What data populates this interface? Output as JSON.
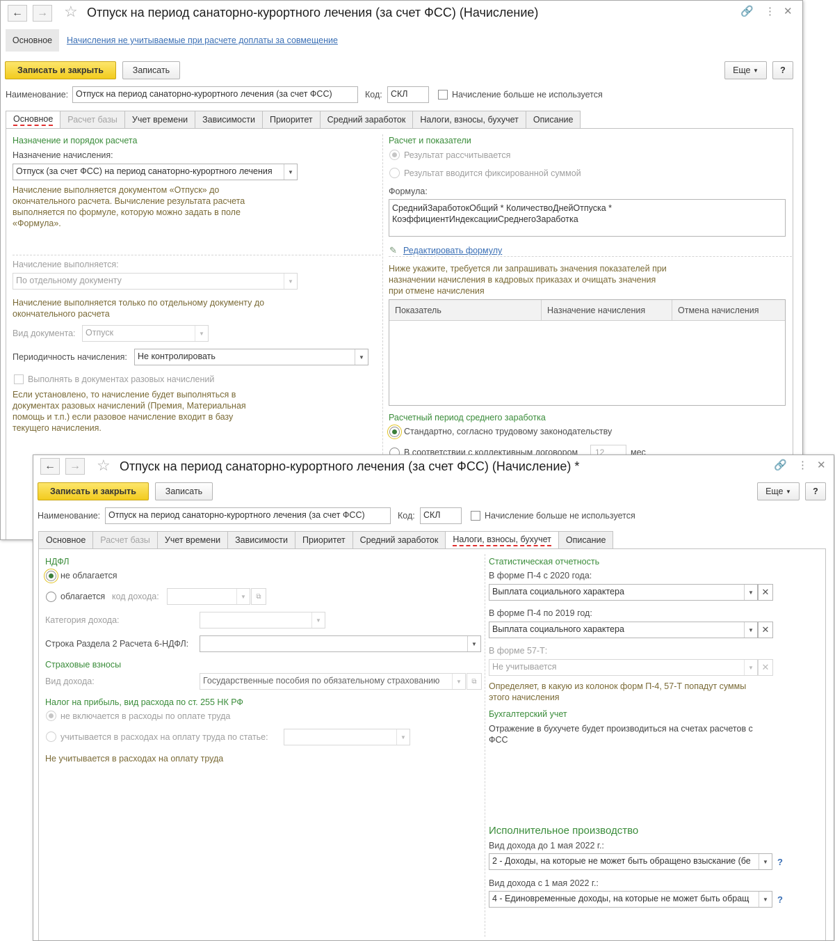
{
  "w1": {
    "title": "Отпуск на период санаторно-курортного лечения (за счет ФСС) (Начисление)",
    "nav": {
      "main": "Основное",
      "link": "Начисления не учитываемые при расчете доплаты за совмещение"
    },
    "toolbar": {
      "save_close": "Записать и закрыть",
      "save": "Записать",
      "more": "Еще",
      "help": "?"
    },
    "name_label": "Наименование:",
    "name_value": "Отпуск на период санаторно-курортного лечения (за счет ФСС)",
    "code_label": "Код:",
    "code_value": "СКЛ",
    "unused": "Начисление больше не используется",
    "tabs": [
      "Основное",
      "Расчет базы",
      "Учет времени",
      "Зависимости",
      "Приоритет",
      "Средний заработок",
      "Налоги, взносы, бухучет",
      "Описание"
    ],
    "left": {
      "section": "Назначение и порядок расчета",
      "purpose_label": "Назначение начисления:",
      "purpose_value": "Отпуск (за счет ФСС) на период санаторно-курортного лечения",
      "purpose_note": "Начисление выполняется документом «Отпуск» до окончательного расчета. Вычисление результата расчета выполняется по формуле, которую можно задать в поле «Формула».",
      "exec_label": "Начисление выполняется:",
      "exec_value": "По отдельному документу",
      "exec_note": "Начисление выполняется только по отдельному документу до окончательного расчета",
      "doc_label": "Вид документа:",
      "doc_value": "Отпуск",
      "period_label": "Периодичность начисления:",
      "period_value": "Не контролировать",
      "onetime_label": "Выполнять в документах разовых начислений",
      "onetime_note": "Если установлено, то начисление будет выполняться в документах разовых начислений (Премия, Материальная помощь и т.п.) если разовое начисление входит в базу текущего начисления."
    },
    "right": {
      "section": "Расчет и показатели",
      "r1": "Результат рассчитывается",
      "r2": "Результат вводится фиксированной суммой",
      "formula_label": "Формула:",
      "formula": "СреднийЗаработокОбщий * КоличествоДнейОтпуска * КоэффициентИндексацииСреднегоЗаработка",
      "edit_link": "Редактировать формулу",
      "ind_note": "Ниже укажите, требуется ли запрашивать значения показателей при назначении начисления в кадровых приказах и очищать значения при отмене начисления",
      "cols": [
        "Показатель",
        "Назначение начисления",
        "Отмена начисления"
      ],
      "avg_section": "Расчетный период среднего заработка",
      "avg_r1": "Стандартно, согласно трудовому законодательству",
      "avg_r2": "В соответствии с коллективным договором",
      "months": "12",
      "mes": "мес"
    }
  },
  "w2": {
    "title": "Отпуск на период санаторно-курортного лечения (за счет ФСС) (Начисление) *",
    "toolbar": {
      "save_close": "Записать и закрыть",
      "save": "Записать",
      "more": "Еще",
      "help": "?"
    },
    "name_label": "Наименование:",
    "name_value": "Отпуск на период санаторно-курортного лечения (за счет ФСС)",
    "code_label": "Код:",
    "code_value": "СКЛ",
    "unused": "Начисление больше не используется",
    "tabs": [
      "Основное",
      "Расчет базы",
      "Учет времени",
      "Зависимости",
      "Приоритет",
      "Средний заработок",
      "Налоги, взносы, бухучет",
      "Описание"
    ],
    "left": {
      "ndfl": "НДФЛ",
      "not_taxed": "не облагается",
      "taxed": "облагается",
      "income_code": "код дохода:",
      "cat_label": "Категория дохода:",
      "row6_label": "Строка Раздела 2 Расчета 6-НДФЛ:",
      "ins": "Страховые взносы",
      "ins_kind_label": "Вид дохода:",
      "ins_kind_value": "Государственные пособия по обязательному страхованию",
      "profit": "Налог на прибыль, вид расхода по ст. 255 НК РФ",
      "p1": "не включается в расходы по оплате труда",
      "p2": "учитывается в расходах на оплату труда по статье:",
      "p_note": "Не учитывается в расходах на оплату труда"
    },
    "right": {
      "stat": "Статистическая отчетность",
      "p4_2020_label": "В форме П-4 с 2020 года:",
      "p4_2020_value": "Выплата социального характера",
      "p4_2019_label": "В форме П-4 по 2019 год:",
      "p4_2019_value": "Выплата социального характера",
      "f57_label": "В форме 57-Т:",
      "f57_value": "Не учитывается",
      "f_note": "Определяет, в какую из колонок форм П-4, 57-Т попадут суммы этого начисления",
      "acc": "Бухгалтерский учет",
      "acc_note": "Отражение в бухучете будет производиться на счетах расчетов с ФСС",
      "exec": "Исполнительное производство",
      "before_label": "Вид дохода до 1 мая 2022 г.:",
      "before_value": "2 - Доходы, на которые не может быть обращено взыскание (бе",
      "after_label": "Вид дохода с 1 мая 2022 г.:",
      "after_value": "4 - Единовременные доходы, на которые не может быть обращ",
      "help": "?"
    }
  }
}
